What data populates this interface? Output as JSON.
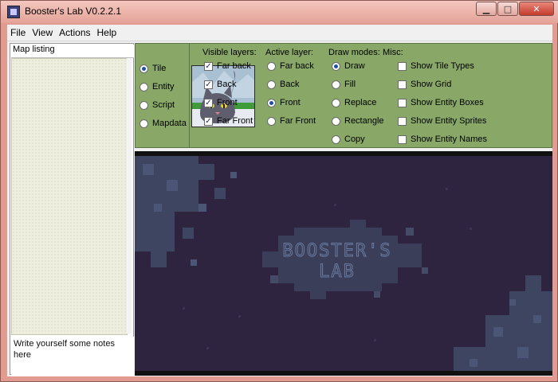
{
  "window": {
    "title": "Booster's Lab V0.2.2.1",
    "controls": {
      "minimize_icon": "minimize-icon",
      "maximize_icon": "maximize-icon",
      "close_icon": "close-icon"
    }
  },
  "menu": {
    "items": [
      "File",
      "View",
      "Actions",
      "Help"
    ]
  },
  "left_panel": {
    "map_listing_label": "Map listing",
    "notes": "Write yourself some notes here"
  },
  "toolbar": {
    "edit_modes": [
      {
        "label": "Tile",
        "checked": true
      },
      {
        "label": "Entity",
        "checked": false
      },
      {
        "label": "Script",
        "checked": false
      },
      {
        "label": "Mapdata",
        "checked": false
      }
    ],
    "visible_layers": {
      "header": "Visible layers:",
      "items": [
        {
          "label": "Far back",
          "checked": true
        },
        {
          "label": "Back",
          "checked": true
        },
        {
          "label": "Front",
          "checked": true
        },
        {
          "label": "Far Front",
          "checked": true
        }
      ]
    },
    "active_layer": {
      "header": "Active layer:",
      "items": [
        {
          "label": "Far back",
          "checked": false
        },
        {
          "label": "Back",
          "checked": false
        },
        {
          "label": "Front",
          "checked": true
        },
        {
          "label": "Far Front",
          "checked": false
        }
      ]
    },
    "draw_modes": {
      "header": "Draw modes:",
      "items": [
        {
          "label": "Draw",
          "checked": true
        },
        {
          "label": "Fill",
          "checked": false
        },
        {
          "label": "Replace",
          "checked": false
        },
        {
          "label": "Rectangle",
          "checked": false
        },
        {
          "label": "Copy",
          "checked": false
        }
      ]
    },
    "misc": {
      "header": "Misc:",
      "items": [
        {
          "label": "Show Tile Types",
          "checked": false
        },
        {
          "label": "Show Grid",
          "checked": false
        },
        {
          "label": "Show Entity Boxes",
          "checked": false
        },
        {
          "label": "Show Entity Sprites",
          "checked": false
        },
        {
          "label": "Show Entity Names",
          "checked": false
        }
      ]
    }
  },
  "map": {
    "logo_text_1": "BOOSTER'S",
    "logo_text_2": "LAB"
  },
  "colors": {
    "toolbar_green": "#89a868",
    "map_bg": "#2e2440",
    "title_bar": "#e9b3aa"
  }
}
